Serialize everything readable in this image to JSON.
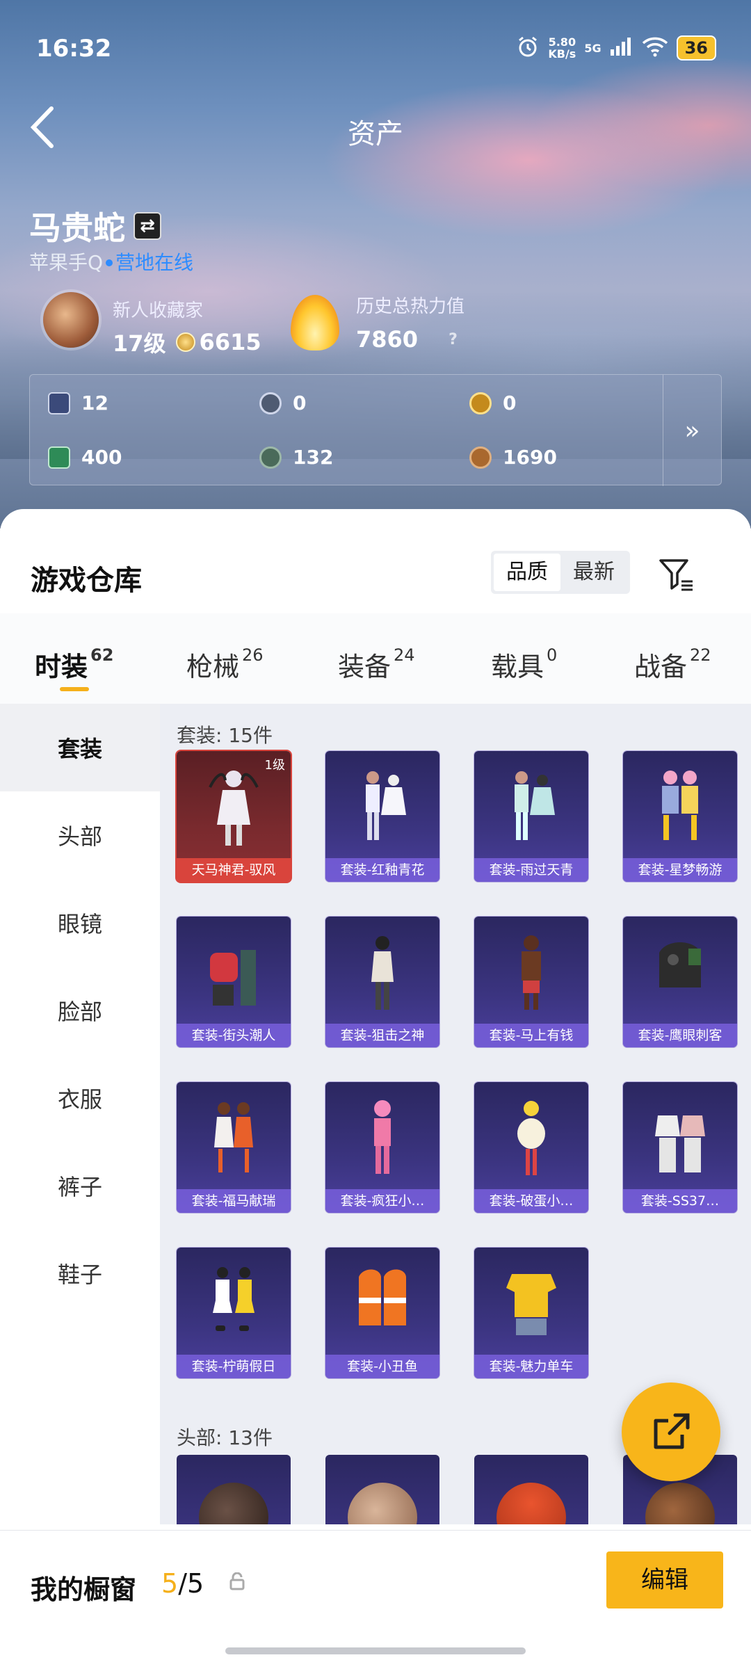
{
  "status": {
    "time": "16:32",
    "speed_top": "5.80",
    "speed_bottom": "KB/s",
    "network": "5G",
    "battery": "36"
  },
  "header": {
    "title": "资产"
  },
  "profile": {
    "name": "马贵蛇",
    "platform": "苹果手Q",
    "online": "营地在线",
    "collector_title": "新人收藏家",
    "level": "17级",
    "coins": "6615",
    "heat_label": "历史总热力值",
    "heat_value": "7860",
    "heat_help": "?"
  },
  "assets": [
    {
      "value": "12",
      "icon": "card-icon",
      "color": "#3b4a7a"
    },
    {
      "value": "0",
      "icon": "silver-coin-icon",
      "color": "#4f5b72"
    },
    {
      "value": "0",
      "icon": "gold-coin-icon",
      "color": "#c48a1c"
    },
    {
      "value": "400",
      "icon": "green-card-icon",
      "color": "#2e8b57"
    },
    {
      "value": "132",
      "icon": "gem-icon",
      "color": "#4a6a5a"
    },
    {
      "value": "1690",
      "icon": "bronze-coin-icon",
      "color": "#a9682e"
    }
  ],
  "warehouse": {
    "title": "游戏仓库",
    "sort_quality": "品质",
    "sort_latest": "最新"
  },
  "tabs": [
    {
      "label": "时装",
      "count": "62"
    },
    {
      "label": "枪械",
      "count": "26"
    },
    {
      "label": "装备",
      "count": "24"
    },
    {
      "label": "载具",
      "count": "0"
    },
    {
      "label": "战备",
      "count": "22"
    }
  ],
  "sidebar": [
    "套装",
    "头部",
    "眼镜",
    "脸部",
    "衣服",
    "裤子",
    "鞋子"
  ],
  "sections": {
    "suits_label": "套装: 15件",
    "heads_label": "头部: 13件"
  },
  "suits": [
    {
      "name": "天马神君-驭风",
      "level": "1级"
    },
    {
      "name": "套装-红釉青花"
    },
    {
      "name": "套装-雨过天青"
    },
    {
      "name": "套装-星梦畅游"
    },
    {
      "name": "套装-街头潮人"
    },
    {
      "name": "套装-狙击之神"
    },
    {
      "name": "套装-马上有钱"
    },
    {
      "name": "套装-鹰眼刺客"
    },
    {
      "name": "套装-福马献瑞"
    },
    {
      "name": "套装-疯狂小…"
    },
    {
      "name": "套装-破蛋小…"
    },
    {
      "name": "套装-SS37…"
    },
    {
      "name": "套装-柠萌假日"
    },
    {
      "name": "套装-小丑鱼"
    },
    {
      "name": "套装-魅力单车"
    }
  ],
  "bottom": {
    "label": "我的橱窗",
    "current": "5",
    "sep": "/",
    "total": "5",
    "edit": "编辑"
  },
  "colors": {
    "accent": "#f8b51a",
    "online": "#2d8cff",
    "rare": "#d9443c"
  }
}
